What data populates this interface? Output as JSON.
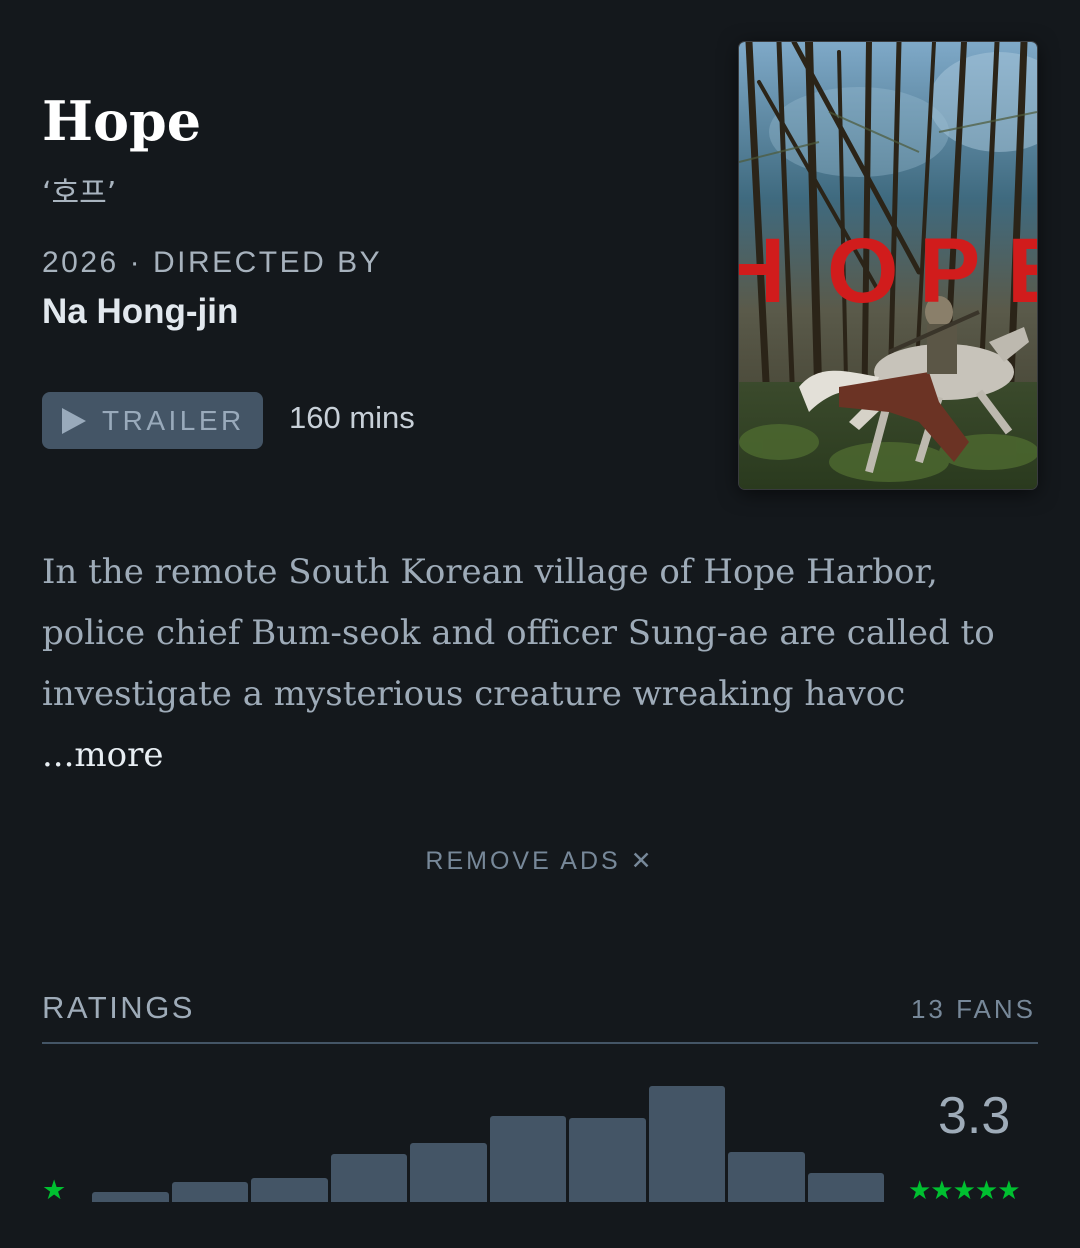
{
  "film": {
    "title": "Hope",
    "original_title": "‘호프’",
    "year": "2026",
    "meta_separator": "·",
    "directed_by_label": "DIRECTED BY",
    "director": "Na Hong-jin",
    "trailer_label": "TRAILER",
    "runtime": "160 mins",
    "poster_word": "HOPE"
  },
  "synopsis": {
    "text": "In the remote South Korean village of Hope Harbor, police chief Bum-seok and officer Sung-ae are called to investigate a mysterious creature wreaking havoc ",
    "more_label": "...more"
  },
  "ads": {
    "remove_label": "REMOVE ADS ✕"
  },
  "ratings": {
    "heading": "RATINGS",
    "fans_label": "13 FANS",
    "average": "3.3",
    "low_star": "★",
    "high_stars": "★★★★★",
    "histogram": [
      0.09,
      0.17,
      0.21,
      0.41,
      0.51,
      0.74,
      0.72,
      1.0,
      0.43,
      0.25
    ]
  },
  "colors": {
    "background": "#14181c",
    "bar": "#445566",
    "star_green": "#00c030",
    "poster_title_red": "#d11c1c"
  },
  "icons": {
    "trailer": "play-icon",
    "remove_ads": "close-icon",
    "rating_star": "star-icon"
  }
}
